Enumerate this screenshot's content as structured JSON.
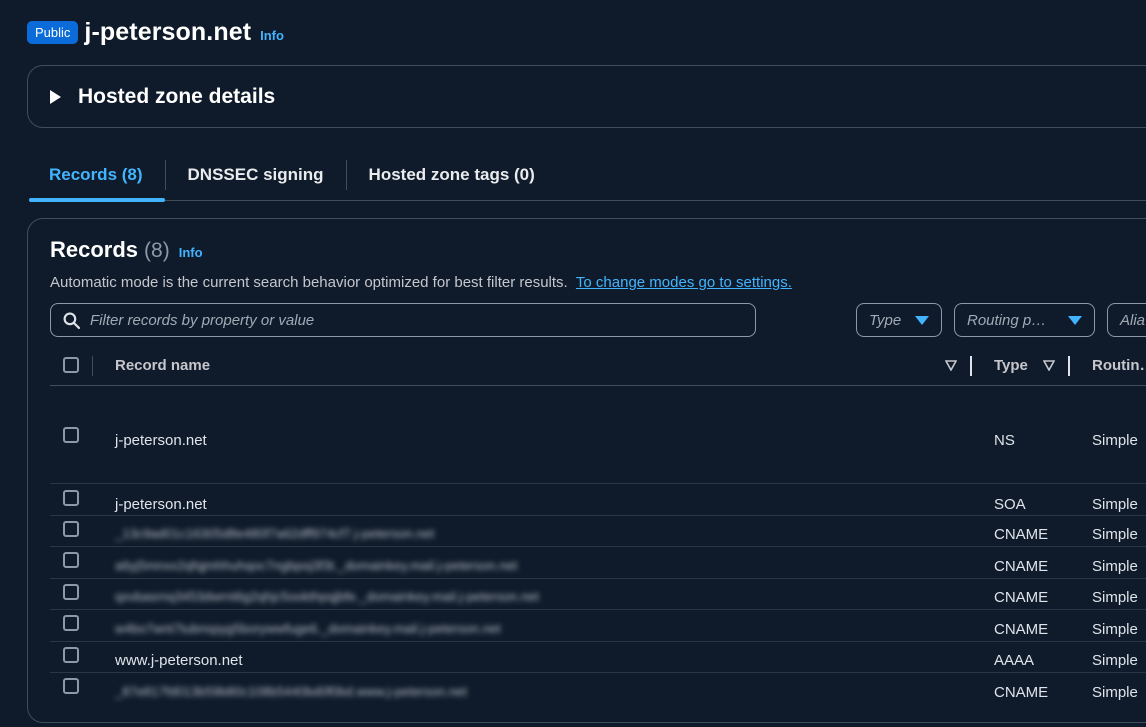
{
  "header": {
    "badge": "Public",
    "title": "j-peterson.net",
    "info": "Info"
  },
  "details": {
    "label": "Hosted zone details"
  },
  "tabs": [
    {
      "label": "Records (8)",
      "active": true
    },
    {
      "label": "DNSSEC signing",
      "active": false
    },
    {
      "label": "Hosted zone tags (0)",
      "active": false
    }
  ],
  "records": {
    "title": "Records",
    "count": "(8)",
    "info": "Info",
    "description": "Automatic mode is the current search behavior optimized for best filter results.",
    "settings_link": "To change modes go to settings.",
    "search_placeholder": "Filter records by property or value",
    "filters": {
      "type": "Type",
      "routing": "Routing p…",
      "alias": "Alia"
    },
    "columns": {
      "name": "Record name",
      "type": "Type",
      "routing": "Routin…"
    },
    "rows": [
      {
        "name": "j-peterson.net",
        "type": "NS",
        "routing": "Simple",
        "blurred": false
      },
      {
        "name": "j-peterson.net",
        "type": "SOA",
        "routing": "Simple",
        "blurred": false
      },
      {
        "name": "_13c9ad01c16305d8e480f7a62dff974cf7.j-peterson.net",
        "type": "CNAME",
        "routing": "Simple",
        "blurred": true
      },
      {
        "name": "a6yj5mnxx2qfqjmhhuhqoc7ngbpoj3f3t._domainkey.mail.j-peterson.net",
        "type": "CNAME",
        "routing": "Simple",
        "blurred": true
      },
      {
        "name": "qxvbasrnq3453dwrnt6g2qhjc5ookthpqjbfe._domainkey.mail.j-peterson.net",
        "type": "CNAME",
        "routing": "Simple",
        "blurred": true
      },
      {
        "name": "w4bo7wnt7tubnspyg5borywwfuge6._domainkey.mail.j-peterson.net",
        "type": "CNAME",
        "routing": "Simple",
        "blurred": true
      },
      {
        "name": "www.j-peterson.net",
        "type": "AAAA",
        "routing": "Simple",
        "blurred": false
      },
      {
        "name": "_87e817fd013b59b80c108b5440bd0f0bd.www.j-peterson.net",
        "type": "CNAME",
        "routing": "Simple",
        "blurred": true
      }
    ]
  },
  "colors": {
    "background": "#0f1b2a",
    "accent": "#42b4ff",
    "badge": "#0b6cd9",
    "border": "#414d5c"
  }
}
